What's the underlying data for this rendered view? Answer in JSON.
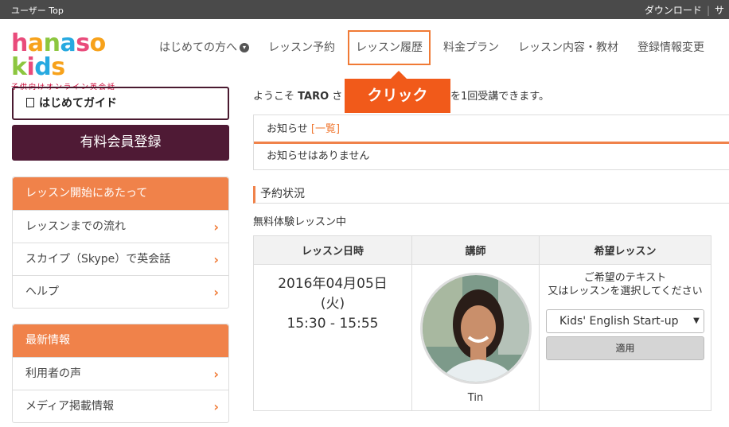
{
  "topbar": {
    "crumb": "ユーザー Top",
    "links": [
      "ダウンロード",
      "サ"
    ]
  },
  "logo": {
    "text": "hanaso kids",
    "sub": "子供向けオンライン英会話",
    "letter_colors": [
      "#e94b7b",
      "#f7a21b",
      "#8cc63f",
      "#26a9e0",
      "#e94b7b",
      "#f7a21b",
      "#8cc63f",
      "#e94b7b",
      "#26a9e0",
      "#f7a21b",
      "#8cc63f"
    ]
  },
  "nav": {
    "items": [
      "はじめての方へ",
      "レッスン予約",
      "レッスン履歴",
      "料金プラン",
      "レッスン内容・教材",
      "登録情報変更"
    ],
    "highlighted_index": 2,
    "dropdown_icon": "chevron-down-circle-icon"
  },
  "callout": {
    "text": "クリック",
    "color": "#f15a1a"
  },
  "sidebar": {
    "guide_button": "はじめてガイド",
    "paid_button": "有料会員登録",
    "panels": [
      {
        "title": "レッスン開始にあたって",
        "items": [
          "レッスンまでの流れ",
          "スカイプ（Skype）で英会話",
          "ヘルプ"
        ]
      },
      {
        "title": "最新情報",
        "items": [
          "利用者の声",
          "メディア掲載情報"
        ]
      }
    ]
  },
  "welcome": {
    "prefix": "ようこそ",
    "name": "TARO",
    "suffix": "さ",
    "rest": "を1回受講できます。"
  },
  "notice": {
    "title": "お知らせ",
    "link": "[一覧]",
    "body": "お知らせはありません"
  },
  "reservation": {
    "title": "予約状況",
    "status": "無料体験レッスン中",
    "headers": [
      "レッスン日時",
      "講師",
      "希望レッスン"
    ],
    "date": "2016年04月05日",
    "weekday": "(火)",
    "time": "15:30 - 15:55",
    "teacher": "Tin",
    "wish_text": "ご希望のテキスト\n又はレッスンを選択してください",
    "select_value": "Kids' English Start-up",
    "apply_button": "適用"
  },
  "colors": {
    "accent": "#f0824a",
    "brand_dark": "#4f1a35"
  }
}
